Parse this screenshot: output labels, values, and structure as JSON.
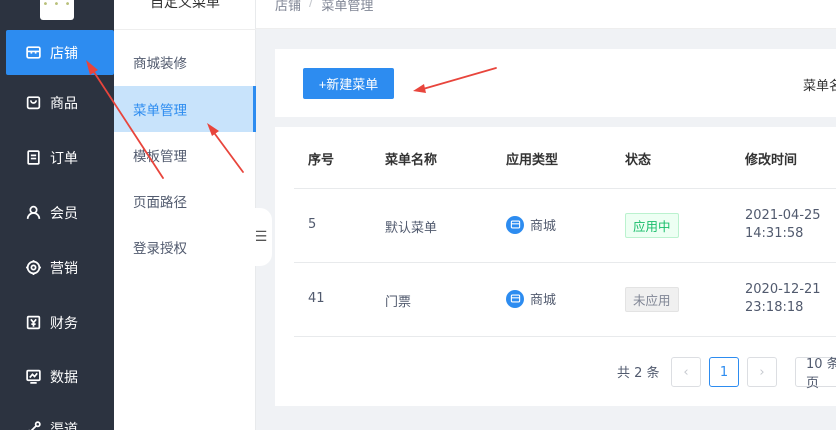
{
  "sidebar": {
    "items": [
      {
        "label": "店铺",
        "icon": "store-icon",
        "active": true
      },
      {
        "label": "商品",
        "icon": "bag-icon"
      },
      {
        "label": "订单",
        "icon": "order-icon"
      },
      {
        "label": "会员",
        "icon": "user-icon"
      },
      {
        "label": "营销",
        "icon": "marketing-icon"
      },
      {
        "label": "财务",
        "icon": "yen-icon"
      },
      {
        "label": "数据",
        "icon": "chart-icon"
      },
      {
        "label": "渠道",
        "icon": "channel-icon"
      }
    ]
  },
  "submenu": {
    "title": "自定义菜单",
    "items": [
      {
        "label": "商城装修"
      },
      {
        "label": "菜单管理",
        "active": true
      },
      {
        "label": "模板管理"
      },
      {
        "label": "页面路径"
      },
      {
        "label": "登录授权"
      }
    ]
  },
  "breadcrumb": {
    "root": "店铺",
    "sep": "/",
    "current": "菜单管理"
  },
  "toolbar": {
    "new_label": "+新建菜单",
    "filter_label": "菜单名称"
  },
  "table": {
    "headers": [
      "序号",
      "菜单名称",
      "应用类型",
      "状态",
      "修改时间"
    ],
    "rows": [
      {
        "id": "5",
        "name": "默认菜单",
        "type": "商城",
        "status": "应用中",
        "date": "2021-04-25",
        "time": "14:31:58"
      },
      {
        "id": "41",
        "name": "门票",
        "type": "商城",
        "status": "未应用",
        "date": "2020-12-21",
        "time": "23:18:18"
      }
    ]
  },
  "pager": {
    "total": "共 2 条",
    "prev": "‹",
    "page": "1",
    "next": "›",
    "size": "10 条/页"
  },
  "colors": {
    "primary": "#2d8cf0",
    "sidebar": "#2c3340",
    "annotation": "#e8453c"
  }
}
